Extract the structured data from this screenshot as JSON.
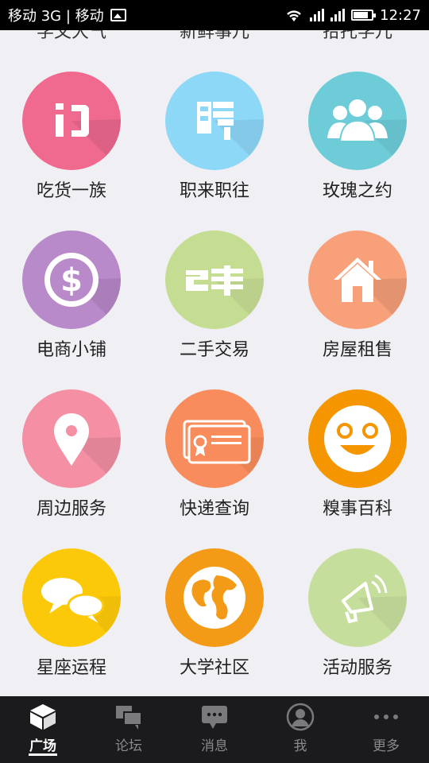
{
  "status_bar": {
    "carrier": "移动 3G | 移动",
    "time": "12:27"
  },
  "top_partial_labels": [
    "学文大气",
    "新鲜事儿",
    "拾托学儿"
  ],
  "tiles": [
    {
      "label": "吃货一族",
      "icon": "chopsticks-icon",
      "color": "#f06a90"
    },
    {
      "label": "职来职往",
      "icon": "hire-icon",
      "color": "#8dd7f7"
    },
    {
      "label": "玫瑰之约",
      "icon": "people-icon",
      "color": "#6dccd8"
    },
    {
      "label": "电商小铺",
      "icon": "dollar-icon",
      "color": "#b98ac9"
    },
    {
      "label": "二手交易",
      "icon": "second-hand-icon",
      "color": "#c5dc93"
    },
    {
      "label": "房屋租售",
      "icon": "house-icon",
      "color": "#f8a07a"
    },
    {
      "label": "周边服务",
      "icon": "location-pin-icon",
      "color": "#f590a4"
    },
    {
      "label": "快递查询",
      "icon": "package-icon",
      "color": "#f88c5c"
    },
    {
      "label": "糗事百科",
      "icon": "smiley-icon",
      "color": "#f59500"
    },
    {
      "label": "星座运程",
      "icon": "chat-bubbles-icon",
      "color": "#fcc90a"
    },
    {
      "label": "大学社区",
      "icon": "globe-icon",
      "color": "#f39a17"
    },
    {
      "label": "活动服务",
      "icon": "speaker-icon",
      "color": "#c6de9c"
    }
  ],
  "tab_bar": [
    {
      "label": "广场",
      "icon": "cube-icon",
      "active": true
    },
    {
      "label": "论坛",
      "icon": "forum-icon",
      "active": false
    },
    {
      "label": "消息",
      "icon": "message-icon",
      "active": false
    },
    {
      "label": "我",
      "icon": "user-icon",
      "active": false
    },
    {
      "label": "更多",
      "icon": "more-icon",
      "active": false
    }
  ]
}
